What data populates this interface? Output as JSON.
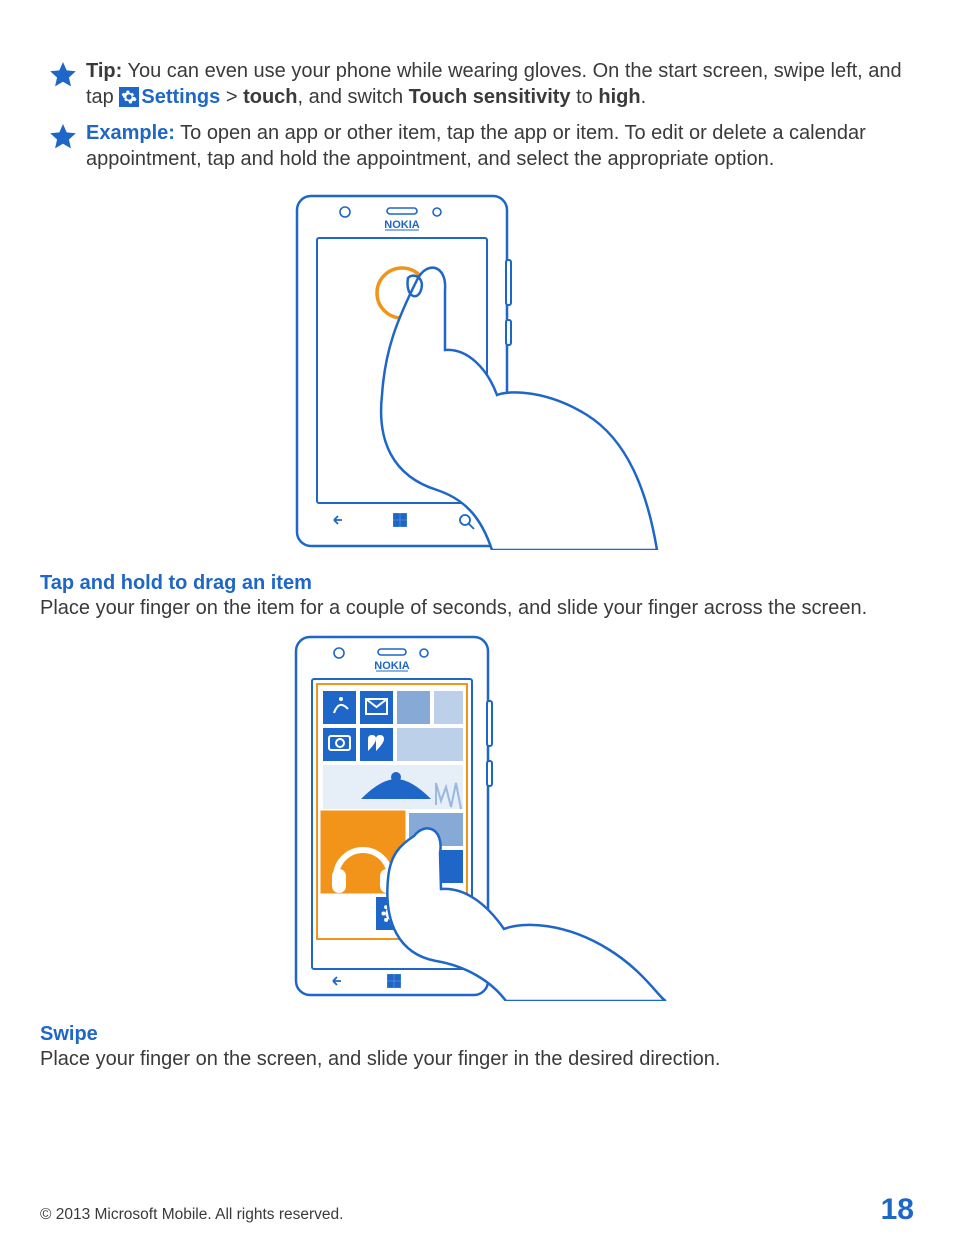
{
  "tip": {
    "label": "Tip:",
    "line1_prefix": " You can even use your phone while wearing gloves. On the start screen, swipe left, and tap ",
    "settings": "Settings",
    "gt": " > ",
    "touch": "touch",
    "after_touch": ", and switch ",
    "sensitivity": "Touch sensitivity",
    "to": " to ",
    "high": "high",
    "period": "."
  },
  "example": {
    "label": "Example:",
    "text": " To open an app or other item, tap the app or item. To edit or delete a calendar appointment, tap and hold the appointment, and select the appropriate option."
  },
  "section1": {
    "title": "Tap and hold to drag an item",
    "body": "Place your finger on the item for a couple of seconds, and slide your finger across the screen."
  },
  "section2": {
    "title": "Swipe",
    "body": "Place your finger on the screen, and slide your finger in the desired direction."
  },
  "footer": {
    "copyright": "© 2013 Microsoft Mobile. All rights reserved.",
    "page": "18"
  }
}
